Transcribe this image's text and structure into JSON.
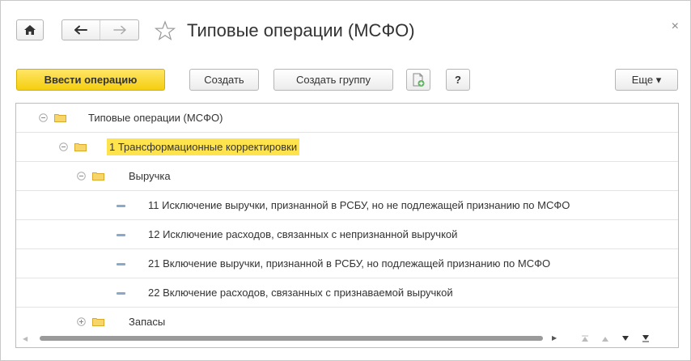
{
  "window": {
    "title": "Типовые операции (МСФО)",
    "close_glyph": "×"
  },
  "toolbar": {
    "primary_label": "Ввести операцию",
    "create_label": "Создать",
    "create_group_label": "Создать группу",
    "help_label": "?",
    "more_label": "Еще ▾"
  },
  "tree": {
    "rows": [
      {
        "label": "Типовые операции (МСФО)",
        "type": "group",
        "expanded": true
      },
      {
        "label": "1 Трансформационные корректировки",
        "type": "group",
        "expanded": true,
        "selected": true
      },
      {
        "label": "Выручка",
        "type": "group",
        "expanded": true
      },
      {
        "label": "11 Исключение выручки, признанной в РСБУ, но не подлежащей признанию по МСФО",
        "type": "item"
      },
      {
        "label": "12  Исключение расходов, связанных с непризнанной выручкой",
        "type": "item"
      },
      {
        "label": "21 Включение выручки, признанной в РСБУ, но подлежащей признанию по МСФО",
        "type": "item"
      },
      {
        "label": "22  Включение расходов, связанных с признаваемой выручкой",
        "type": "item"
      },
      {
        "label": "Запасы",
        "type": "group",
        "expanded": false
      }
    ]
  },
  "colors": {
    "primary_button": "#f5cf0f",
    "selection": "#ffe34d",
    "folder": "#f2c94c",
    "item_marker": "#8aa9c7"
  },
  "icons": {
    "home": "home-icon",
    "back": "arrow-left-icon",
    "forward": "arrow-right-icon",
    "favorite": "star-outline-icon",
    "copy": "copy-document-icon",
    "folder": "folder-icon"
  }
}
